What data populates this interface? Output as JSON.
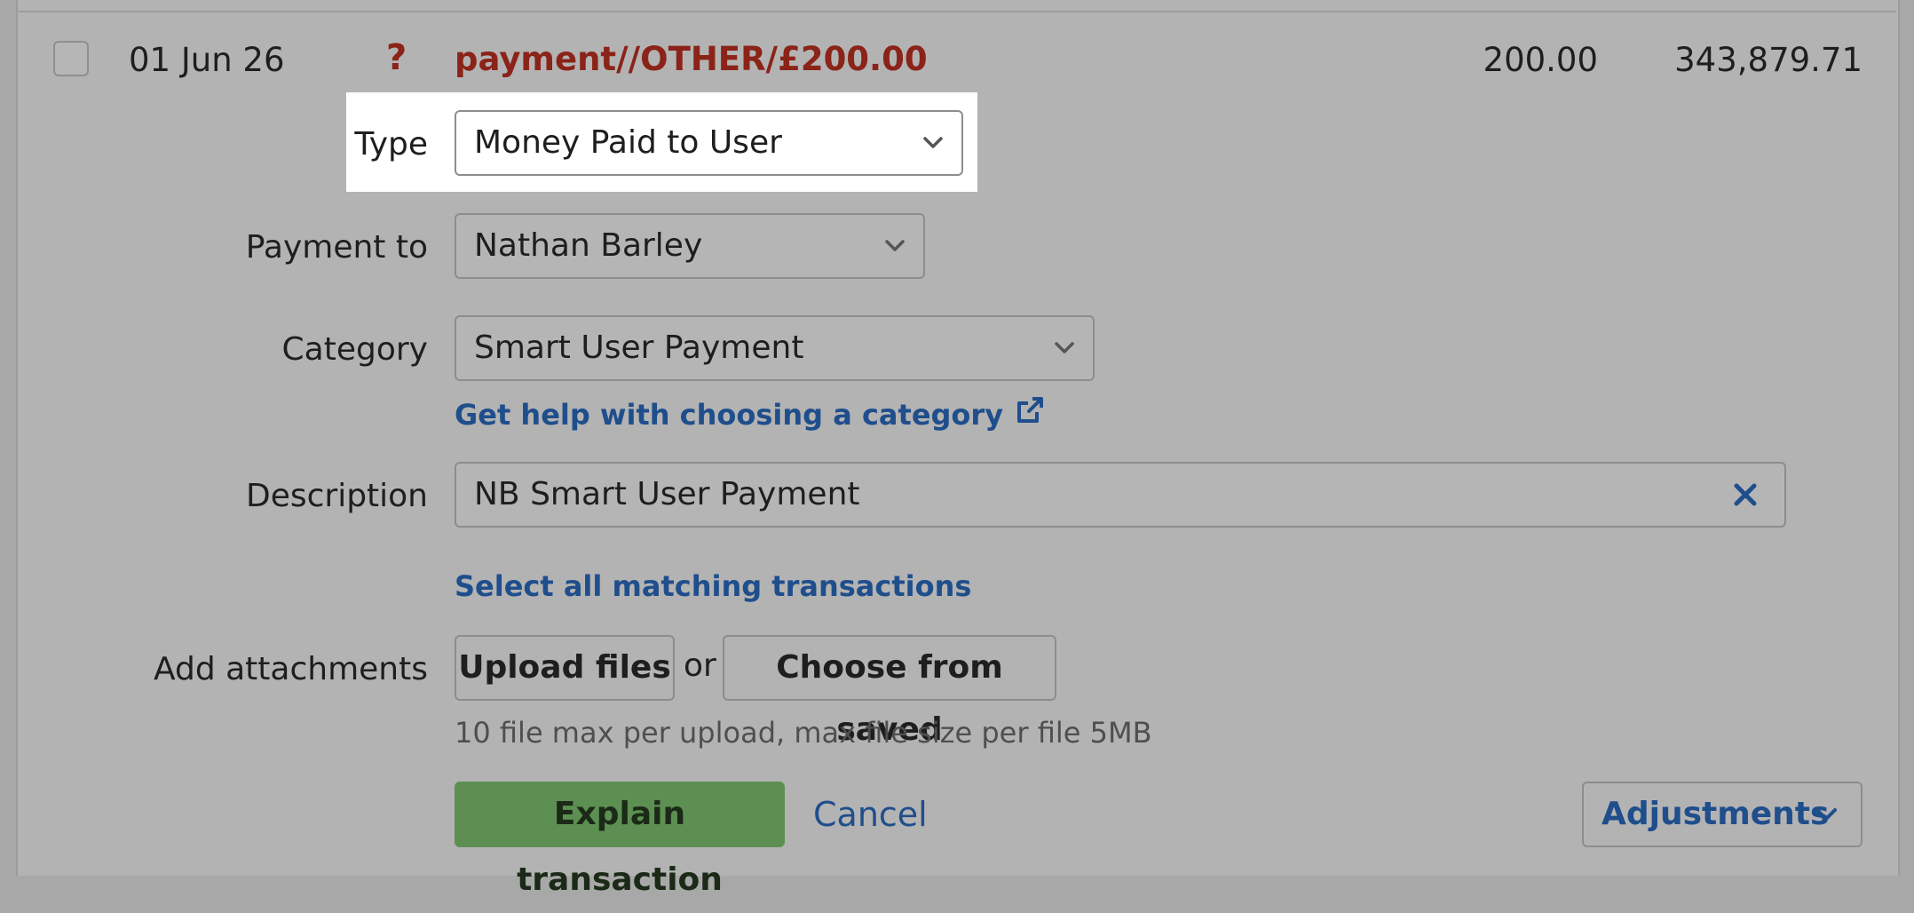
{
  "transaction": {
    "date": "01 Jun 26",
    "status_glyph": "?",
    "description": "payment//OTHER/£200.00",
    "amount": "200.00",
    "balance": "343,879.71"
  },
  "form": {
    "type_label": "Type",
    "type_value": "Money Paid to User",
    "payment_to_label": "Payment to",
    "payment_to_value": "Nathan Barley",
    "category_label": "Category",
    "category_value": "Smart User Payment",
    "category_help_link": "Get help with choosing a category",
    "description_label": "Description",
    "description_value": "NB Smart User Payment",
    "select_matching_link": "Select all matching transactions",
    "attachments_label": "Add attachments",
    "upload_button": "Upload files",
    "or_text": "or",
    "choose_saved_button": "Choose from saved",
    "upload_hint": "10 file max per upload, max file size per file 5MB"
  },
  "actions": {
    "explain_button": "Explain transaction",
    "cancel_link": "Cancel",
    "adjustments_button": "Adjustments"
  },
  "icons": {
    "status": "question-mark-icon",
    "dropdown": "chevron-down-icon",
    "external": "external-link-icon",
    "clear": "close-icon"
  },
  "colors": {
    "unexplained_red": "#8b2318",
    "link_blue": "#1f4e8c",
    "primary_green": "#5d8f53",
    "highlight": "#ffffff"
  }
}
